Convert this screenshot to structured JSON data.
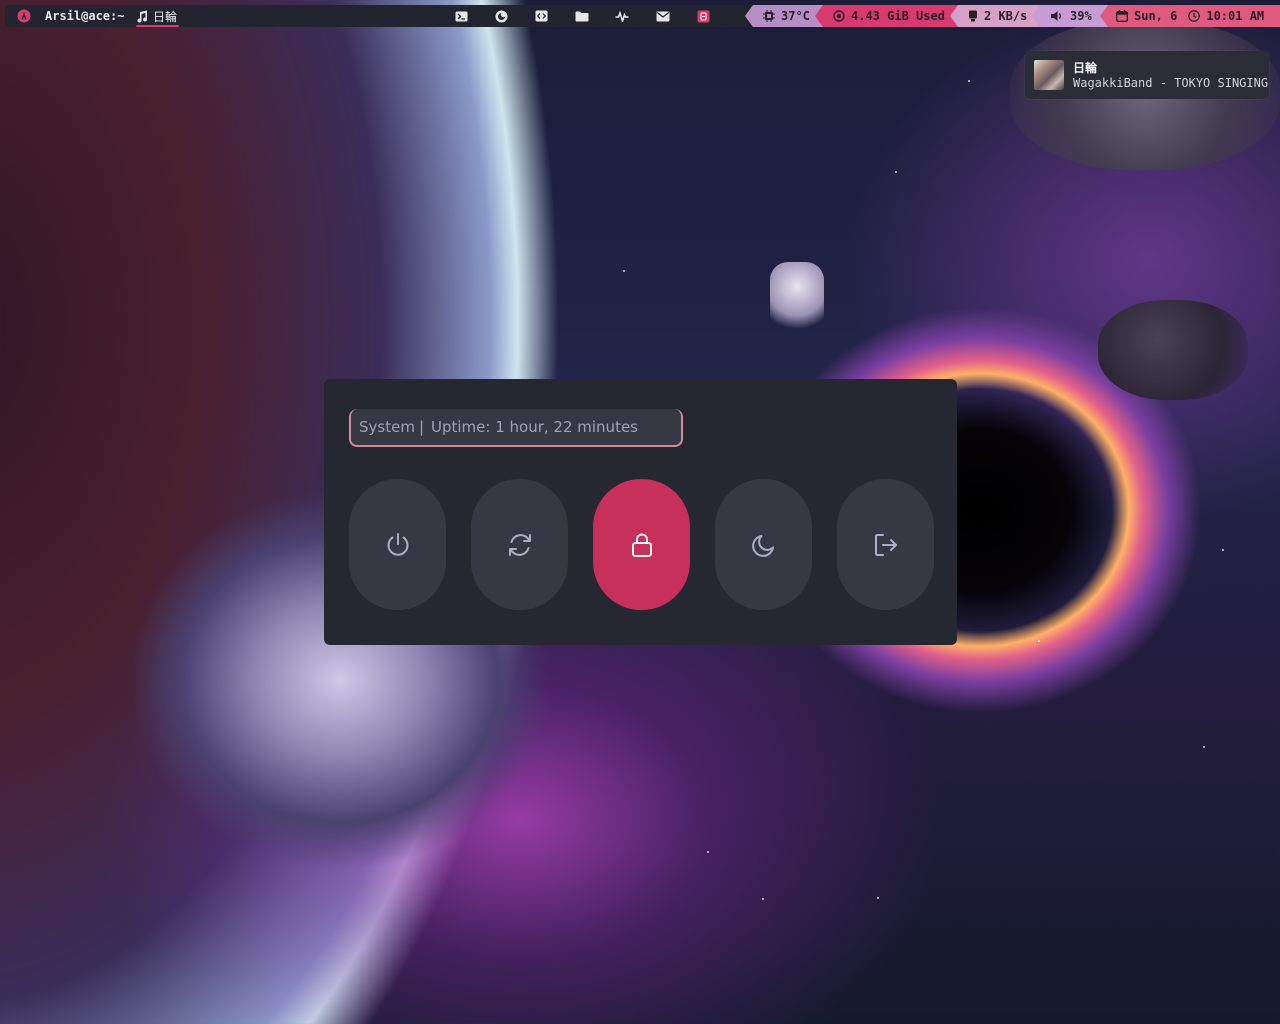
{
  "topbar": {
    "launcher_icon": "arch-logo-icon",
    "window_title": "Arsil@ace:~",
    "media_title": "日輪",
    "media_icon": "music-note-icon",
    "app_icons": [
      "terminal-icon",
      "firefox-icon",
      "code-icon",
      "folder-icon",
      "activity-icon",
      "mail-icon",
      "app-icon"
    ],
    "temperature": "37°C",
    "memory": "4.43 GiB Used",
    "network": "2 KB/s",
    "volume": "39%",
    "date": "Sun, 6",
    "time": "10:01 AM",
    "colors": {
      "bar_bg": "#22252f",
      "accent": "#d73a6c",
      "temp_bg": "#b48ec5",
      "memory_bg": "#d73a6c",
      "network_bg": "#d6a0c7",
      "volume_bg": "#c79cd4",
      "date_bg": "#e0597f"
    }
  },
  "notification": {
    "title": "日輪",
    "body": "WagakkiBand - TOKYO SINGING"
  },
  "power_menu": {
    "prompt_label": "System",
    "prompt_separator": "|",
    "uptime": "Uptime: 1 hour, 22 minutes",
    "buttons": [
      {
        "name": "shutdown",
        "icon": "power-icon",
        "selected": false
      },
      {
        "name": "reboot",
        "icon": "refresh-icon",
        "selected": false
      },
      {
        "name": "lock",
        "icon": "lock-icon",
        "selected": true
      },
      {
        "name": "suspend",
        "icon": "moon-icon",
        "selected": false
      },
      {
        "name": "logout",
        "icon": "logout-icon",
        "selected": false
      }
    ],
    "colors": {
      "panel_bg": "#252831",
      "button_bg": "#363944",
      "selected_bg": "#c6305a"
    }
  }
}
